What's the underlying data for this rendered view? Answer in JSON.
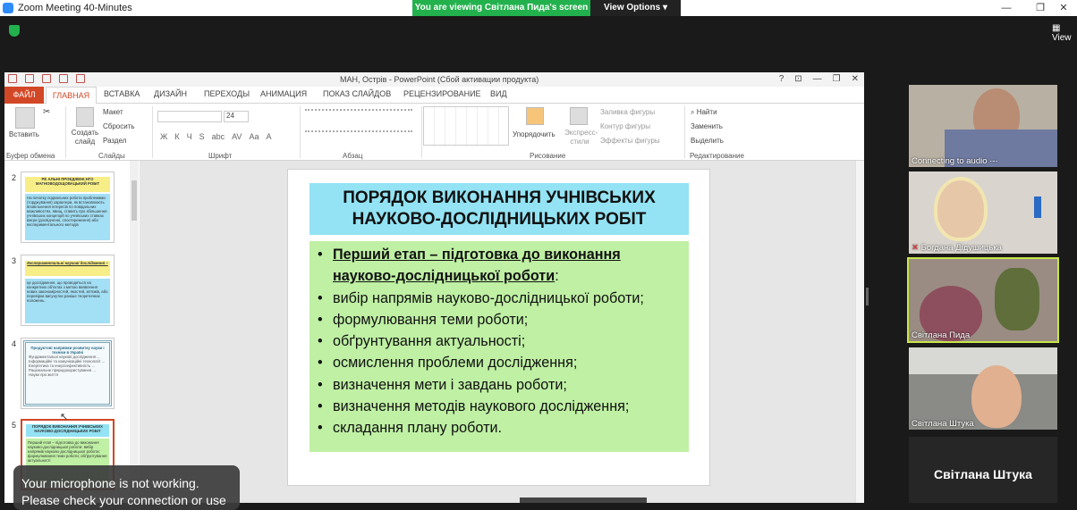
{
  "zoom": {
    "title": "Zoom Meeting 40-Minutes",
    "banner_text": "You are viewing Світлана Пида's screen",
    "view_options": "View Options ▾",
    "view_label": "View",
    "window_controls": [
      "—",
      "❐",
      "✕"
    ]
  },
  "ppt": {
    "title": "МАН, Острів - PowerPoint (Сбой активации продукта)",
    "title_controls": [
      "?",
      "⊡",
      "—",
      "❐",
      "✕"
    ],
    "tabs": [
      "ФАЙЛ",
      "ГЛАВНАЯ",
      "ВСТАВКА",
      "ДИЗАЙН",
      "ПЕРЕХОДЫ",
      "АНИМАЦИЯ",
      "ПОКАЗ СЛАЙДОВ",
      "РЕЦЕНЗИРОВАНИЕ",
      "ВИД"
    ],
    "ribbon": {
      "paste": "Вставить",
      "cut_icon": "scissors-icon",
      "create_slide": "Создать слайд",
      "layout": "Макет",
      "reset": "Сбросить",
      "section": "Раздел",
      "font_size": "24",
      "font_buttons": [
        "Ж",
        "К",
        "Ч",
        "S",
        "abc",
        "AV",
        "Aa",
        "A"
      ],
      "arrange": "Упорядочить",
      "quick_styles": "Экспресс-стили",
      "shape_fill": "Заливка фигуры",
      "shape_outline": "Контур фигуры",
      "shape_effects": "Эффекты фигуры",
      "find": "Найти",
      "replace": "Заменить",
      "select": "Выделить",
      "groups": [
        "Буфер обмена",
        "Слайды",
        "Шрифт",
        "Абзац",
        "Рисование",
        "Редактирование"
      ]
    },
    "thumbnails": [
      {
        "num": "2",
        "title": "РЕ АЛЬНІ ПРОЕДЖЕНІ НГО МАГНОВОДОЩОВАЦЬКИЙ РОБІТ",
        "body": "На початку подвальних роботи проблемами (торджування) характери, як встановлюють вповільнення інтересів по повідальних можливостях, явищ, ставить про збільшення учнівських концепцій по учнівських ставках вжгри (досвідченні, спостереження) або експериментального методів"
      },
      {
        "num": "3",
        "title": "Експериментальні наукові дослідження –",
        "body": "це дослідження, що проводяться на конкретних об'єктах з метою виявлення нових закономірностей, якостей, зв'язків, або перевірки висунутих раніше теоретичних положень."
      },
      {
        "num": "4",
        "title": "Продуктові напрямки розвитку науки і техніки в Україні",
        "body": "Фундаментальні наукові дослідження ... Інформаційні та комунікаційні технології ... Енергетика та енергоефективність ... Раціональне природокористування ... Науки про життя"
      },
      {
        "num": "5",
        "title": "ПОРЯДОК ВИКОНАННЯ УЧНІВСЬКИХ НАУКОВО-ДОСЛІДНИЦЬКИХ РОБІТ",
        "body": "Перший етап – підготовка до виконання науково-дослідницької роботи: вибір напрямів науково-дослідницької роботи; формулювання теми роботи; обґрунтування актуальності"
      }
    ],
    "slide": {
      "title": "ПОРЯДОК ВИКОНАННЯ УЧНІВСЬКИХ НАУКОВО-ДОСЛІДНИЦЬКИХ РОБІТ",
      "heading": "Перший етап – підготовка до виконання науково-дослідницької роботи",
      "heading_suffix": ":",
      "items": [
        "вибір напрямів науково-дослідницької роботи;",
        "формулювання теми роботи;",
        "обґрунтування актуальності;",
        "осмислення проблеми дослідження;",
        "визначення мети і завдань роботи;",
        "визначення методів наукового дослідження;",
        "складання плану роботи."
      ],
      "title_bg": "#93e3f4",
      "body_bg": "#bff0a4"
    }
  },
  "participants": [
    {
      "name": "Connecting to audio ·-·",
      "bg": "#b8b0a2"
    },
    {
      "name": "Богдана Дідушицька",
      "bg": "#d9d4ce"
    },
    {
      "name": "Світлана Пида",
      "bg": "#9a8c83"
    },
    {
      "name": "Світлана Штука",
      "bg": "#8a8a86"
    },
    {
      "name": "Світлана Штука",
      "bg": "#262626"
    }
  ],
  "toast": {
    "line1": "Your microphone is not working.",
    "line2": "Please check your connection or use"
  },
  "colors": {
    "accent": "#d24726",
    "zoom_green": "#23b14d",
    "speaker_highlight": "#c8e64a"
  }
}
